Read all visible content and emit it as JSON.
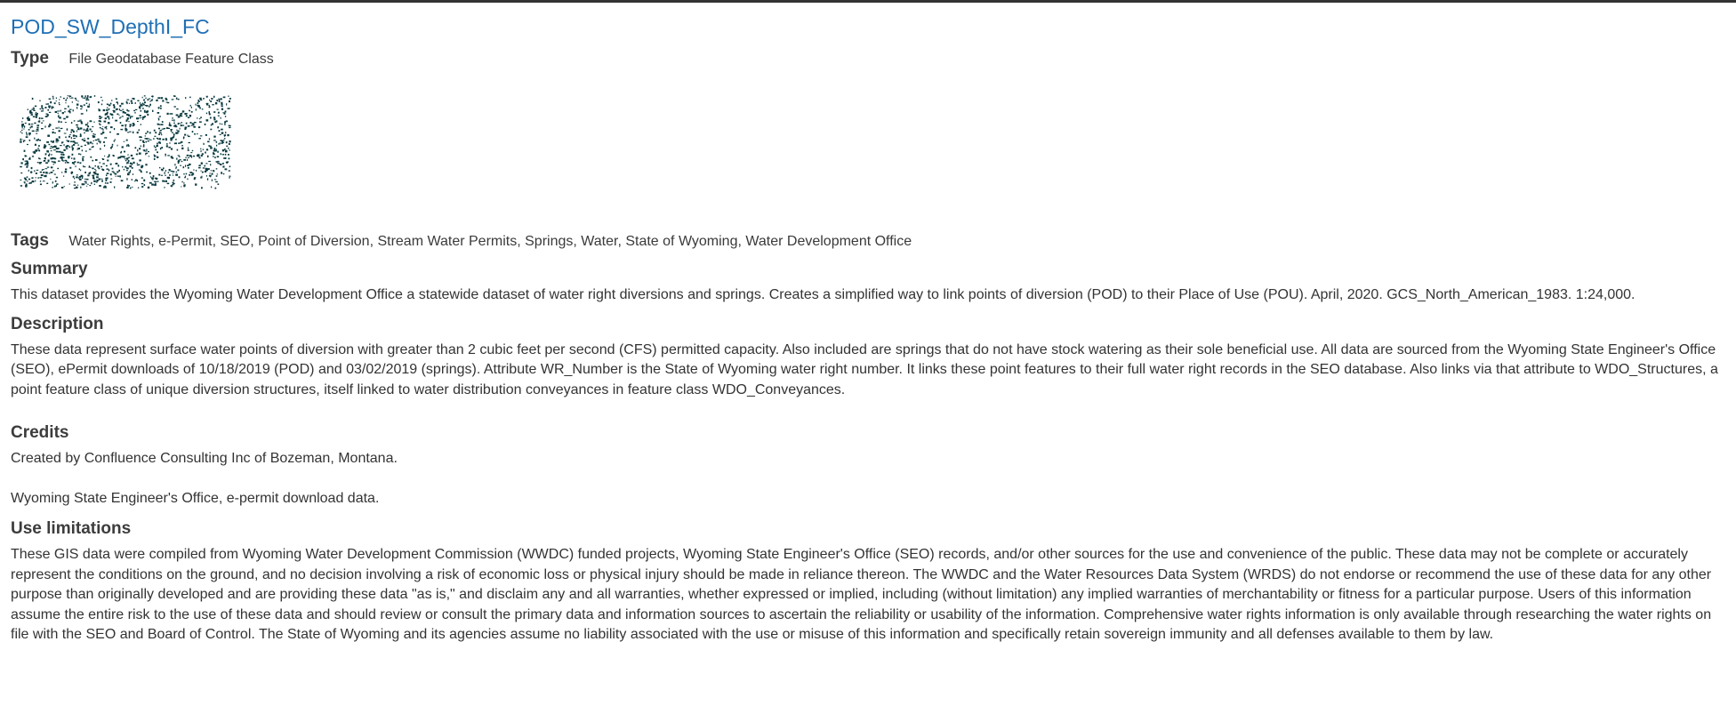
{
  "item": {
    "title": "POD_SW_DepthI_FC",
    "type_label": "Type",
    "type_value": "File Geodatabase Feature Class"
  },
  "thumbnail": {
    "icon": "map-thumbnail-image",
    "point_color": "#0b3a40"
  },
  "tags": {
    "label": "Tags",
    "value": "Water Rights, e-Permit, SEO, Point of Diversion, Stream Water Permits, Springs, Water, State of Wyoming, Water Development Office"
  },
  "summary": {
    "heading": "Summary",
    "text": "This dataset provides the Wyoming Water Development Office a statewide dataset of water right diversions and springs.  Creates a simplified way to link points of diversion (POD) to their Place of Use (POU).    April, 2020. GCS_North_American_1983. 1:24,000."
  },
  "description": {
    "heading": "Description",
    "text": "These data represent surface water points of diversion with greater than 2 cubic feet per second (CFS) permitted capacity. Also included are springs that do not have stock watering as their sole beneficial use. All data are sourced from the Wyoming State Engineer's Office (SEO), ePermit downloads of 10/18/2019 (POD) and 03/02/2019 (springs). Attribute WR_Number is the State of Wyoming water right number. It links these point features to their full water right records in the SEO database. Also links via that attribute to WDO_Structures, a point feature class of unique diversion structures, itself linked to water distribution conveyances in feature class WDO_Conveyances."
  },
  "credits": {
    "heading": "Credits",
    "line1": "Created by Confluence Consulting Inc of Bozeman, Montana.",
    "line2": "Wyoming State Engineer's Office, e-permit download data."
  },
  "use_limitations": {
    "heading": "Use limitations",
    "text": "These GIS data were compiled from Wyoming Water Development Commission (WWDC) funded projects, Wyoming State Engineer's Office (SEO) records, and/or other sources for the use and convenience of the public.  These data may not be complete or accurately represent the conditions  on the ground, and no decision involving a risk of economic loss or physical injury should be made in reliance thereon. The WWDC and the Water Resources Data System (WRDS) do not endorse or recommend the use of these data for any other purpose than originally developed and are providing these data \"as is,\" and disclaim any and all warranties, whether expressed or implied, including (without limitation) any implied warranties of merchantability or fitness for a particular purpose. Users of this information assume the entire risk to the use of these data and should review or consult the primary data and information sources to ascertain the reliability or usability of the information. Comprehensive water rights information is only available through researching the water rights on file with the SEO and Board of Control. The State of Wyoming and its agencies assume no liability associated with the use or misuse of this information and specifically retain sovereign immunity and all defenses available to them by law."
  }
}
